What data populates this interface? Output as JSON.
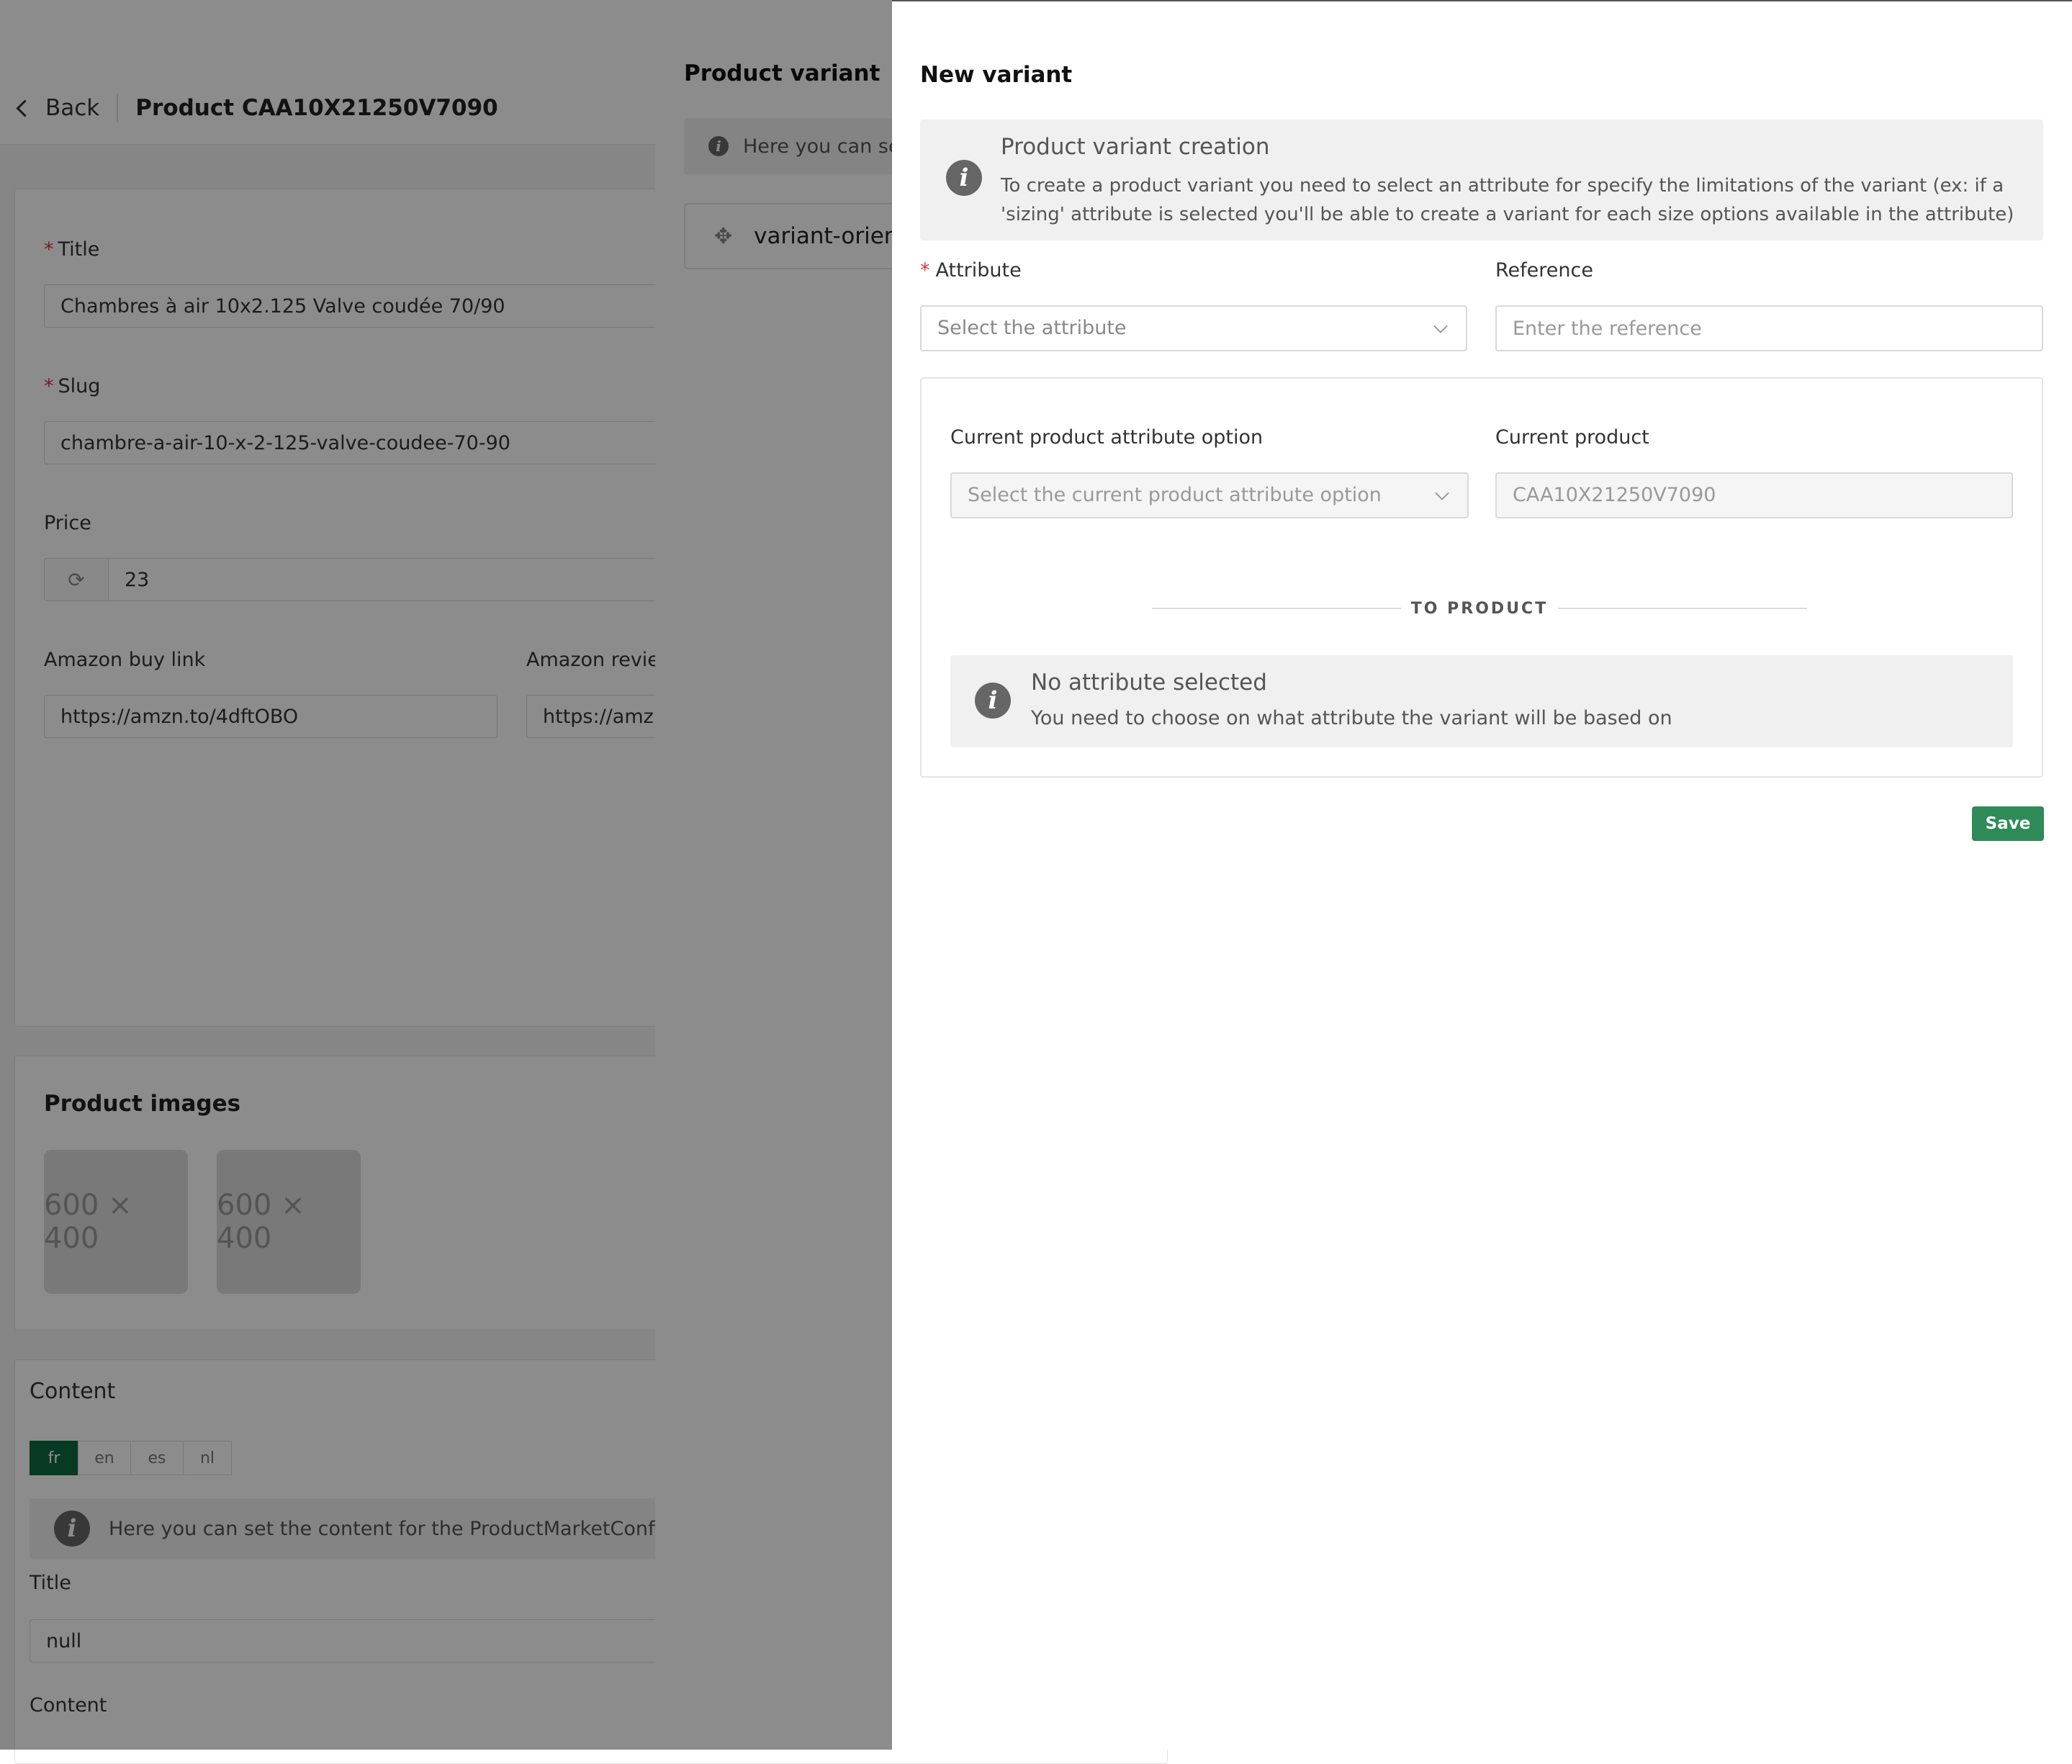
{
  "header": {
    "back_label": "Back",
    "product_title": "Product CAA10X21250V7090"
  },
  "form": {
    "title_label": "Title",
    "title_value": "Chambres à air 10x2.125 Valve coudée 70/90",
    "slug_label": "Slug",
    "slug_value": "chambre-a-air-10-x-2-125-valve-coudee-70-90",
    "price_label": "Price",
    "price_value": "23",
    "amazon_buy_label": "Amazon buy link",
    "amazon_buy_value": "https://amzn.to/4dftOBO",
    "amazon_review_label": "Amazon review",
    "amazon_review_value": "https://amzn"
  },
  "images": {
    "section_title": "Product images",
    "placeholders": [
      "600 × 400",
      "600 × 400"
    ]
  },
  "content": {
    "section_title": "Content",
    "languages": [
      "fr",
      "en",
      "es",
      "nl"
    ],
    "active_language": "fr",
    "info_text": "Here you can set the content for the ProductMarketConfig mo",
    "title_label": "Title",
    "title_value": "null",
    "content_label": "Content"
  },
  "drawer_variant": {
    "title": "Product variant",
    "info_text": "Here you can set",
    "item_label": "variant-orien"
  },
  "new_variant": {
    "title": "New variant",
    "alert_title": "Product variant creation",
    "alert_text": "To create a product variant you need to select an attribute for specify the limitations of the variant (ex: if a 'sizing' attribute is selected you'll be able to create a variant for each size options available in the attribute)",
    "attribute_label": "Attribute",
    "attribute_placeholder": "Select the attribute",
    "reference_label": "Reference",
    "reference_placeholder": "Enter the reference",
    "current_option_label": "Current product attribute option",
    "current_option_placeholder": "Select the current product attribute option",
    "current_product_label": "Current product",
    "current_product_value": "CAA10X21250V7090",
    "divider_text": "TO PRODUCT",
    "no_attr_title": "No attribute selected",
    "no_attr_text": "You need to choose on what attribute the variant will be based on",
    "save_label": "Save"
  },
  "colors": {
    "primary_green": "#2e8b57",
    "active_tab_green": "#0e6b3e",
    "required_red": "#d9363e"
  }
}
